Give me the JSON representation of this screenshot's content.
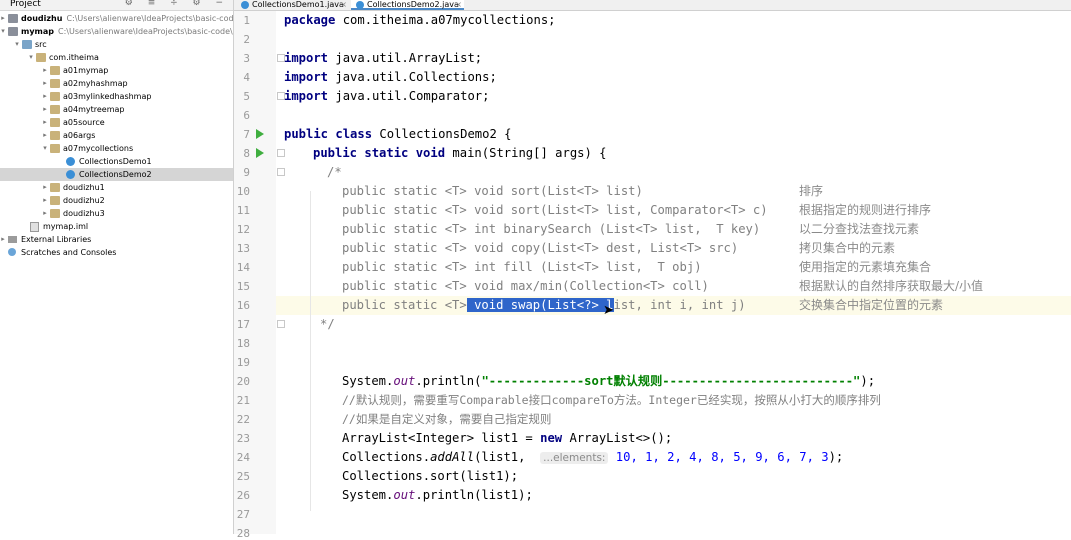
{
  "project": {
    "title": "Project",
    "tree": [
      {
        "label": "doudizhu",
        "path": "C:\\Users\\alienware\\IdeaProjects\\basic-code",
        "bold": true,
        "icon": "module",
        "arrow": "right"
      },
      {
        "label": "mymap",
        "path": "C:\\Users\\alienware\\IdeaProjects\\basic-code\\",
        "bold": true,
        "icon": "module",
        "arrow": "down"
      },
      {
        "label": "src",
        "icon": "folder-src",
        "arrow": "down"
      },
      {
        "label": "com.itheima",
        "icon": "package",
        "arrow": "down"
      },
      {
        "label": "a01mymap",
        "icon": "package",
        "arrow": "right"
      },
      {
        "label": "a02myhashmap",
        "icon": "package",
        "arrow": "right"
      },
      {
        "label": "a03mylinkedhashmap",
        "icon": "package",
        "arrow": "right"
      },
      {
        "label": "a04mytreemap",
        "icon": "package",
        "arrow": "right"
      },
      {
        "label": "a05source",
        "icon": "package",
        "arrow": "right"
      },
      {
        "label": "a06args",
        "icon": "package",
        "arrow": "right"
      },
      {
        "label": "a07mycollections",
        "icon": "package",
        "arrow": "down"
      },
      {
        "label": "CollectionsDemo1",
        "icon": "classfile",
        "arrow": ""
      },
      {
        "label": "CollectionsDemo2",
        "icon": "classfile",
        "arrow": "",
        "selected": true
      },
      {
        "label": "doudizhu1",
        "icon": "package",
        "arrow": "right"
      },
      {
        "label": "doudizhu2",
        "icon": "package",
        "arrow": "right"
      },
      {
        "label": "doudizhu3",
        "icon": "package",
        "arrow": "right"
      },
      {
        "label": "mymap.iml",
        "icon": "iml",
        "arrow": ""
      },
      {
        "label": "External Libraries",
        "icon": "lib",
        "arrow": "right"
      },
      {
        "label": "Scratches and Consoles",
        "icon": "scratch",
        "arrow": ""
      }
    ]
  },
  "tabs": [
    {
      "label": "CollectionsDemo1.java",
      "active": false
    },
    {
      "label": "CollectionsDemo2.java",
      "active": true
    }
  ],
  "editor": {
    "line_numbers": [
      "1",
      "2",
      "3",
      "4",
      "5",
      "6",
      "7",
      "8",
      "9",
      "10",
      "11",
      "12",
      "13",
      "14",
      "15",
      "16",
      "17",
      "18",
      "19",
      "20",
      "21",
      "22",
      "23",
      "24",
      "25",
      "26",
      "27",
      "28"
    ],
    "code": {
      "l1_kw": "package",
      "l1_rest": " com.itheima.a07mycollections;",
      "l3_kw": "import",
      "l3_rest": " java.util.ArrayList;",
      "l4_kw": "import",
      "l4_rest": " java.util.Collections;",
      "l5_kw": "import",
      "l5_rest": " java.util.Comparator;",
      "l7_kw": "public class",
      "l7_rest": " CollectionsDemo2 {",
      "l8_kw": "public static void",
      "l8_rest": " main(String[] args) {",
      "l9": "/*",
      "l10": "public static <T> void sort(List<T> list)",
      "l10_zh": "排序",
      "l11": "public static <T> void sort(List<T> list, Comparator<T> c)",
      "l11_zh": "根据指定的规则进行排序",
      "l12": "public static <T> int binarySearch (List<T> list,  T key)",
      "l12_zh": "以二分查找法查找元素",
      "l13": "public static <T> void copy(List<T> dest, List<T> src)",
      "l13_zh": "拷贝集合中的元素",
      "l14": "public static <T> int fill (List<T> list,  T obj)",
      "l14_zh": "使用指定的元素填充集合",
      "l15": "public static <T> void max/min(Collection<T> coll)",
      "l15_zh": "根据默认的自然排序获取最大/小值",
      "l16_a": "public static <T>",
      "l16_sel": " void swap(List<?> l",
      "l16_b": "ist, int i, int j)",
      "l16_zh": "交换集合中指定位置的元素",
      "l17": "*/",
      "l20_a": "System.",
      "l20_fld": "out",
      "l20_b": ".println(",
      "l20_str": "\"-------------sort默认规则--------------------------\"",
      "l20_c": ");",
      "l21": "//默认规则，需要重写Comparable接口compareTo方法。Integer已经实现，按照从小打大的顺序排列",
      "l22": "//如果是自定义对象，需要自己指定规则",
      "l23_a": "ArrayList<Integer> list1 = ",
      "l23_kw": "new",
      "l23_b": " ArrayList<>();",
      "l24_a": "Collections.",
      "l24_ital": "addAll",
      "l24_b": "(list1,  ",
      "l24_hint": "...elements:",
      "l24_nums": " 10, 1, 2, 4, 8, 5, 9, 6, 7, 3",
      "l24_c": ");",
      "l25": "Collections.sort(list1);",
      "l26_a": "System.",
      "l26_fld": "out",
      "l26_b": ".println(list1);"
    }
  }
}
